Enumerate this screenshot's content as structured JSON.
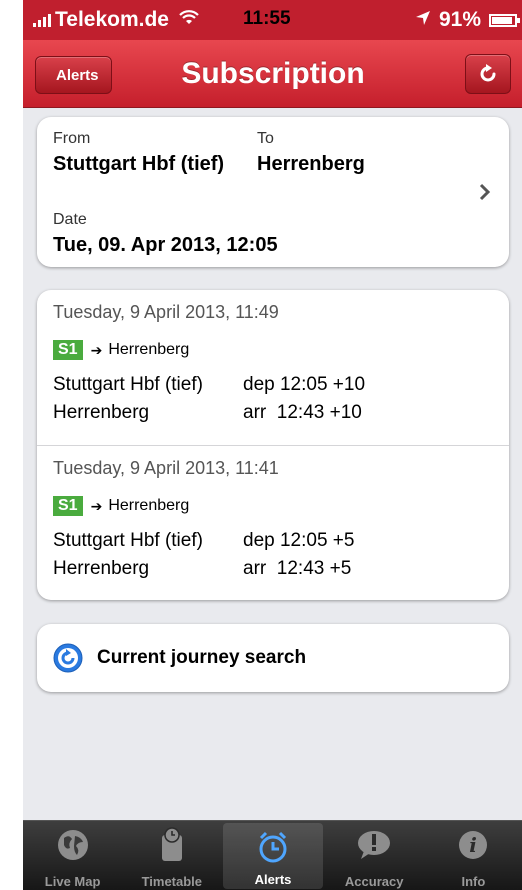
{
  "status_bar": {
    "carrier": "Telekom.de",
    "time": "11:55",
    "battery": "91%",
    "battery_level": 0.91
  },
  "nav": {
    "back_label": "Alerts",
    "title": "Subscription"
  },
  "route": {
    "from_label": "From",
    "from_value": "Stuttgart Hbf (tief)",
    "to_label": "To",
    "to_value": "Herrenberg",
    "date_label": "Date",
    "date_value": "Tue, 09. Apr 2013, 12:05"
  },
  "alerts": [
    {
      "timestamp": "Tuesday, 9 April 2013, 11:49",
      "line": "S1",
      "arrow": "➔",
      "destination": "Herrenberg",
      "rows": [
        {
          "stop": "Stuttgart Hbf (tief)",
          "time": "dep 12:05 +10"
        },
        {
          "stop": "Herrenberg",
          "time": "arr  12:43 +10"
        }
      ]
    },
    {
      "timestamp": "Tuesday, 9 April 2013, 11:41",
      "line": "S1",
      "arrow": "➔",
      "destination": "Herrenberg",
      "rows": [
        {
          "stop": "Stuttgart Hbf (tief)",
          "time": "dep 12:05 +5"
        },
        {
          "stop": "Herrenberg",
          "time": "arr  12:43 +5"
        }
      ]
    }
  ],
  "current_search_label": "Current journey search",
  "tabs": [
    {
      "label": "Live Map",
      "icon": "globe-icon"
    },
    {
      "label": "Timetable",
      "icon": "timetable-icon"
    },
    {
      "label": "Alerts",
      "icon": "alarm-clock-icon",
      "active": true
    },
    {
      "label": "Accuracy",
      "icon": "speech-bubble-exclamation-icon"
    },
    {
      "label": "Info",
      "icon": "info-icon"
    }
  ],
  "colors": {
    "brand_red": "#c51f2c",
    "line_badge_green": "#4aab3e",
    "search_icon_blue": "#2a7ae0"
  }
}
